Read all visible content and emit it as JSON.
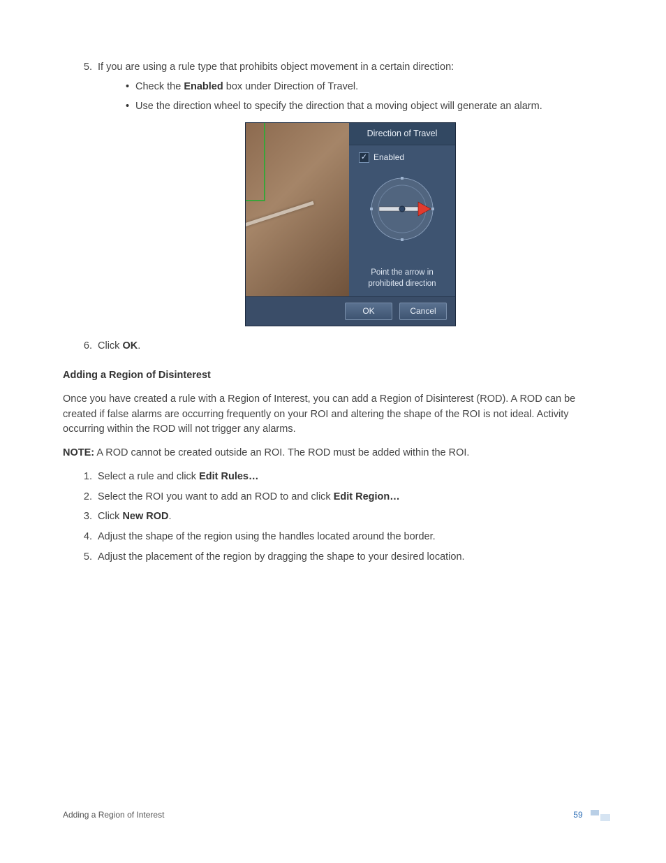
{
  "step5": {
    "number": "5.",
    "text_before": "If you are using a rule type that prohibits object movement in a certain direction:",
    "bullet1_prefix": "Check the ",
    "bullet1_bold": "Enabled",
    "bullet1_suffix": " box under Direction of Travel.",
    "bullet2": "Use the direction wheel to specify the direction that a moving object will generate an alarm."
  },
  "dialog": {
    "panel_title": "Direction of Travel",
    "enabled_label": "Enabled",
    "checkmark": "✓",
    "hint_line1": "Point the arrow in",
    "hint_line2": "prohibited direction",
    "ok": "OK",
    "cancel": "Cancel"
  },
  "step6": {
    "prefix": "Click ",
    "bold": "OK",
    "suffix": "."
  },
  "section_title": "Adding a Region of Disinterest",
  "para1": "Once you have created a rule with a Region of Interest, you can add a Region of Disinterest (ROD). A ROD can be created if false alarms are occurring frequently on your ROI and altering the shape of the ROI is not ideal. Activity occurring within the ROD will not trigger any alarms.",
  "note_label": "NOTE:",
  "note_text": " A ROD cannot be created outside an ROI. The ROD must be added within the ROI.",
  "list2": {
    "i1_prefix": "Select a rule and click ",
    "i1_bold": "Edit Rules…",
    "i2_prefix": "Select the ROI you want to add an ROD to and click ",
    "i2_bold": "Edit Region…",
    "i3_prefix": "Click ",
    "i3_bold": "New ROD",
    "i3_suffix": ".",
    "i4": "Adjust the shape of the region using the handles located around the border.",
    "i5": "Adjust the placement of the region by dragging the shape to your desired location."
  },
  "footer": {
    "left": "Adding a Region of Interest",
    "page": "59"
  }
}
